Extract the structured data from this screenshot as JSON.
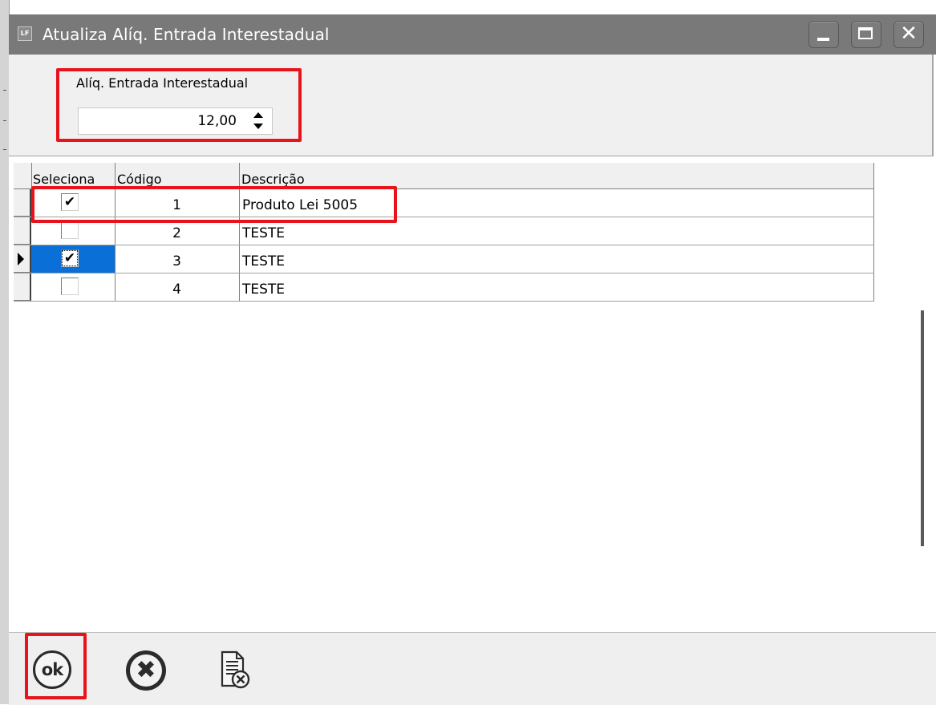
{
  "window": {
    "title": "Atualiza Alíq. Entrada Interestadual",
    "app_icon_text": "LF",
    "minimize_icon": "minimize-icon",
    "maximize_icon": "maximize-icon",
    "close_icon": "close-icon"
  },
  "rate_field": {
    "label": "Alíq. Entrada Interestadual",
    "value": "12,00"
  },
  "grid": {
    "columns": [
      "Seleciona",
      "Código",
      "Descrição"
    ],
    "rows": [
      {
        "selected": true,
        "code": "1",
        "description": "Produto Lei 5005",
        "current": false
      },
      {
        "selected": false,
        "code": "2",
        "description": "TESTE",
        "current": false
      },
      {
        "selected": true,
        "code": "3",
        "description": "TESTE",
        "current": true
      },
      {
        "selected": false,
        "code": "4",
        "description": "TESTE",
        "current": false
      }
    ],
    "checkmark": "✔"
  },
  "toolbar": {
    "ok_label": "ok",
    "ok_icon": "ok-circle-icon",
    "cancel_icon": "cancel-circle-icon",
    "document_icon": "document-cancel-icon"
  },
  "colors": {
    "titlebar": "#797979",
    "highlight": "#e8141c",
    "selection": "#0a6fd6"
  }
}
